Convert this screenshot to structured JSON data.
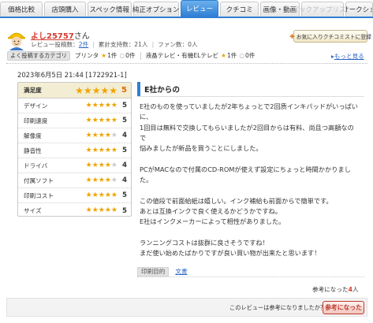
{
  "tabs": [
    {
      "label": "価格比較",
      "state": "normal"
    },
    {
      "label": "店頭購入",
      "state": "normal"
    },
    {
      "label": "スペック情報",
      "state": "normal"
    },
    {
      "label": "純正オプション",
      "state": "normal"
    },
    {
      "label": "レビュー",
      "state": "active"
    },
    {
      "label": "クチコミ",
      "state": "normal"
    },
    {
      "label": "画像・動画",
      "state": "normal"
    },
    {
      "label": "ピックアップリスト",
      "state": "disabled"
    },
    {
      "label": "オークショ",
      "state": "normal"
    }
  ],
  "user": {
    "name": "よし25757",
    "suffix": "さん",
    "review_count_label": "レビュー投稿数：",
    "review_count": "2件",
    "support_label": "累計支持数：21人",
    "fans_label": "ファン数：0人",
    "fav_button": "お気に入りクチコミストに登録"
  },
  "categories": {
    "label": "よく投稿するカテゴリ",
    "items": [
      {
        "name": "プリンタ",
        "stars": "1件",
        "zero": "0件"
      },
      {
        "name": "液晶テレビ・有機ELテレビ",
        "stars": "1件",
        "zero": "0件"
      }
    ],
    "more": "もっと見る"
  },
  "review": {
    "datetime": "2023年6月5日 21:44 [1722921-1]",
    "title": "E社からの",
    "overall_label": "満足度",
    "overall_score": "5",
    "ratings": [
      {
        "label": "デザイン",
        "score": 5
      },
      {
        "label": "印刷速度",
        "score": 5
      },
      {
        "label": "解像度",
        "score": 4
      },
      {
        "label": "静音性",
        "score": 5
      },
      {
        "label": "ドライバ",
        "score": 4
      },
      {
        "label": "付属ソフト",
        "score": 4
      },
      {
        "label": "印刷コスト",
        "score": 5
      },
      {
        "label": "サイズ",
        "score": 5
      }
    ],
    "body_lines": [
      "E社のものを使っていましたが2年ちょっとで2回质インキパッドがいっぱい",
      "に、",
      "1回目は無料で交換してもらいましたが2回目からは有料、尚且つ高額なの",
      "で",
      "悩みましたが新品を買うことにしました。",
      "",
      "PCがMACなので付属のCD-ROMが使えず設定にちょっと時間かかりまし",
      "た。",
      "",
      "この値段で前面給紙は嬉しい。インク補給も前面からで簡単です。",
      "あとは互換インクで良く使えるかどうかですね。",
      "E社はインクメーカーによって相性がありました。",
      "",
      "ランニングコストは抜群に良さそうですね！",
      "まだ使い始めたばかりですが良い買い物が出来たと思います！"
    ],
    "purpose_label": "印刷目的",
    "purpose_value": "文書",
    "helpful_prefix": "参考になった",
    "helpful_count": "4",
    "helpful_suffix": "人",
    "vote_question": "このレビューは参考になりましたか？",
    "vote_button": "参考になった"
  }
}
